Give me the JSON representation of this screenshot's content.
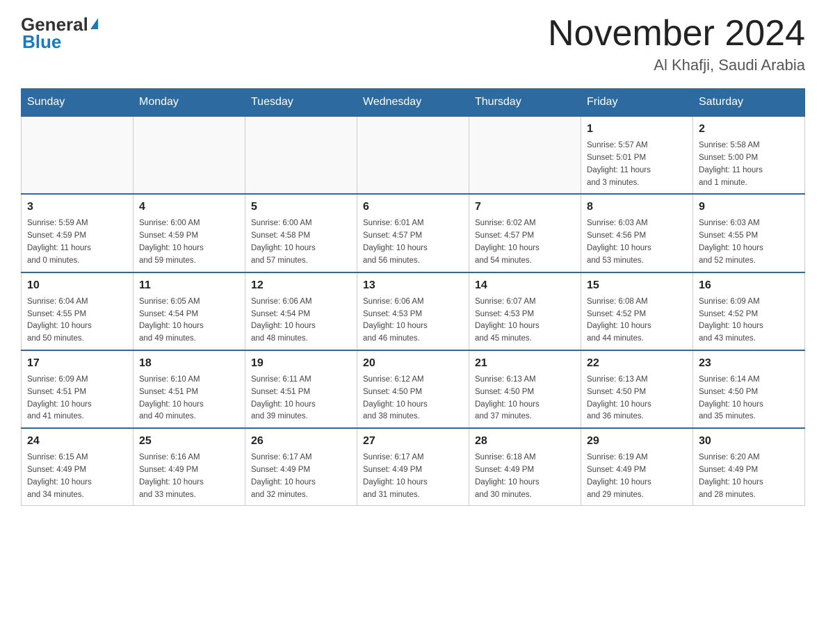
{
  "header": {
    "logo": {
      "general": "General",
      "blue": "Blue",
      "triangle": "▲"
    },
    "title": "November 2024",
    "location": "Al Khafji, Saudi Arabia"
  },
  "calendar": {
    "days_of_week": [
      "Sunday",
      "Monday",
      "Tuesday",
      "Wednesday",
      "Thursday",
      "Friday",
      "Saturday"
    ],
    "weeks": [
      [
        {
          "day": "",
          "info": ""
        },
        {
          "day": "",
          "info": ""
        },
        {
          "day": "",
          "info": ""
        },
        {
          "day": "",
          "info": ""
        },
        {
          "day": "",
          "info": ""
        },
        {
          "day": "1",
          "info": "Sunrise: 5:57 AM\nSunset: 5:01 PM\nDaylight: 11 hours\nand 3 minutes."
        },
        {
          "day": "2",
          "info": "Sunrise: 5:58 AM\nSunset: 5:00 PM\nDaylight: 11 hours\nand 1 minute."
        }
      ],
      [
        {
          "day": "3",
          "info": "Sunrise: 5:59 AM\nSunset: 4:59 PM\nDaylight: 11 hours\nand 0 minutes."
        },
        {
          "day": "4",
          "info": "Sunrise: 6:00 AM\nSunset: 4:59 PM\nDaylight: 10 hours\nand 59 minutes."
        },
        {
          "day": "5",
          "info": "Sunrise: 6:00 AM\nSunset: 4:58 PM\nDaylight: 10 hours\nand 57 minutes."
        },
        {
          "day": "6",
          "info": "Sunrise: 6:01 AM\nSunset: 4:57 PM\nDaylight: 10 hours\nand 56 minutes."
        },
        {
          "day": "7",
          "info": "Sunrise: 6:02 AM\nSunset: 4:57 PM\nDaylight: 10 hours\nand 54 minutes."
        },
        {
          "day": "8",
          "info": "Sunrise: 6:03 AM\nSunset: 4:56 PM\nDaylight: 10 hours\nand 53 minutes."
        },
        {
          "day": "9",
          "info": "Sunrise: 6:03 AM\nSunset: 4:55 PM\nDaylight: 10 hours\nand 52 minutes."
        }
      ],
      [
        {
          "day": "10",
          "info": "Sunrise: 6:04 AM\nSunset: 4:55 PM\nDaylight: 10 hours\nand 50 minutes."
        },
        {
          "day": "11",
          "info": "Sunrise: 6:05 AM\nSunset: 4:54 PM\nDaylight: 10 hours\nand 49 minutes."
        },
        {
          "day": "12",
          "info": "Sunrise: 6:06 AM\nSunset: 4:54 PM\nDaylight: 10 hours\nand 48 minutes."
        },
        {
          "day": "13",
          "info": "Sunrise: 6:06 AM\nSunset: 4:53 PM\nDaylight: 10 hours\nand 46 minutes."
        },
        {
          "day": "14",
          "info": "Sunrise: 6:07 AM\nSunset: 4:53 PM\nDaylight: 10 hours\nand 45 minutes."
        },
        {
          "day": "15",
          "info": "Sunrise: 6:08 AM\nSunset: 4:52 PM\nDaylight: 10 hours\nand 44 minutes."
        },
        {
          "day": "16",
          "info": "Sunrise: 6:09 AM\nSunset: 4:52 PM\nDaylight: 10 hours\nand 43 minutes."
        }
      ],
      [
        {
          "day": "17",
          "info": "Sunrise: 6:09 AM\nSunset: 4:51 PM\nDaylight: 10 hours\nand 41 minutes."
        },
        {
          "day": "18",
          "info": "Sunrise: 6:10 AM\nSunset: 4:51 PM\nDaylight: 10 hours\nand 40 minutes."
        },
        {
          "day": "19",
          "info": "Sunrise: 6:11 AM\nSunset: 4:51 PM\nDaylight: 10 hours\nand 39 minutes."
        },
        {
          "day": "20",
          "info": "Sunrise: 6:12 AM\nSunset: 4:50 PM\nDaylight: 10 hours\nand 38 minutes."
        },
        {
          "day": "21",
          "info": "Sunrise: 6:13 AM\nSunset: 4:50 PM\nDaylight: 10 hours\nand 37 minutes."
        },
        {
          "day": "22",
          "info": "Sunrise: 6:13 AM\nSunset: 4:50 PM\nDaylight: 10 hours\nand 36 minutes."
        },
        {
          "day": "23",
          "info": "Sunrise: 6:14 AM\nSunset: 4:50 PM\nDaylight: 10 hours\nand 35 minutes."
        }
      ],
      [
        {
          "day": "24",
          "info": "Sunrise: 6:15 AM\nSunset: 4:49 PM\nDaylight: 10 hours\nand 34 minutes."
        },
        {
          "day": "25",
          "info": "Sunrise: 6:16 AM\nSunset: 4:49 PM\nDaylight: 10 hours\nand 33 minutes."
        },
        {
          "day": "26",
          "info": "Sunrise: 6:17 AM\nSunset: 4:49 PM\nDaylight: 10 hours\nand 32 minutes."
        },
        {
          "day": "27",
          "info": "Sunrise: 6:17 AM\nSunset: 4:49 PM\nDaylight: 10 hours\nand 31 minutes."
        },
        {
          "day": "28",
          "info": "Sunrise: 6:18 AM\nSunset: 4:49 PM\nDaylight: 10 hours\nand 30 minutes."
        },
        {
          "day": "29",
          "info": "Sunrise: 6:19 AM\nSunset: 4:49 PM\nDaylight: 10 hours\nand 29 minutes."
        },
        {
          "day": "30",
          "info": "Sunrise: 6:20 AM\nSunset: 4:49 PM\nDaylight: 10 hours\nand 28 minutes."
        }
      ]
    ]
  }
}
